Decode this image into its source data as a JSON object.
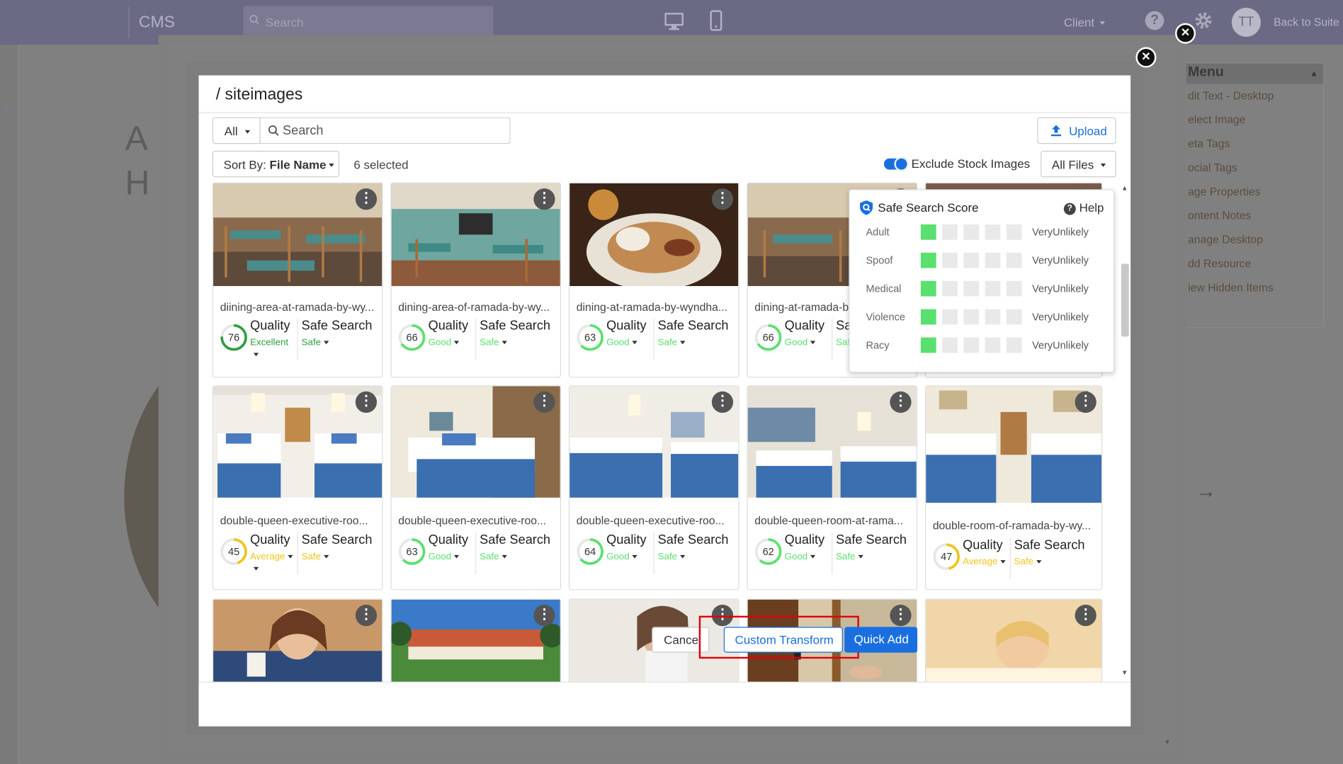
{
  "app": {
    "name": "CMS",
    "search_placeholder": "Search",
    "client_label": "Client",
    "avatar_initials": "TT",
    "back_to_suite": "Back to Suite"
  },
  "background": {
    "heading_line1": "A",
    "heading_line2": "H"
  },
  "right_menu": {
    "title": "Menu",
    "items": [
      "dit Text - Desktop",
      "elect Image",
      "eta Tags",
      "ocial Tags",
      "age Properties",
      "ontent Notes",
      "anage Desktop",
      "dd Resource",
      "iew Hidden Items"
    ]
  },
  "picker": {
    "title": "/ siteimages",
    "filter_all": "All",
    "search_placeholder": "Search",
    "upload_label": "Upload",
    "sort_by_label": "Sort By:",
    "sort_by_value": "File Name",
    "selected_count": "6 selected",
    "exclude_stock_label": "Exclude Stock Images",
    "exclude_stock_on": true,
    "all_files_label": "All Files"
  },
  "labels": {
    "quality": "Quality",
    "safe_search": "Safe Search"
  },
  "colors": {
    "excellent": "#2e9e3e",
    "good": "#5ae06e",
    "average": "#f0c419",
    "accent": "#1a6fe0",
    "highlight": "#e0000b"
  },
  "images": [
    {
      "name": "diining-area-at-ramada-by-wy...",
      "score": 76,
      "quality": "Excellent",
      "safe": "Safe",
      "theme": "dining1"
    },
    {
      "name": "dining-area-of-ramada-by-wy...",
      "score": 66,
      "quality": "Good",
      "safe": "Safe",
      "theme": "dining2"
    },
    {
      "name": "dining-at-ramada-by-wyndha...",
      "score": 63,
      "quality": "Good",
      "safe": "Safe",
      "theme": "food"
    },
    {
      "name": "dining-at-ramada-b",
      "score": 66,
      "quality": "Good",
      "safe": "Safe",
      "theme": "dining3"
    },
    {
      "name": "",
      "score": null,
      "quality": "",
      "safe": "",
      "theme": "partial"
    },
    {
      "name": "double-queen-executive-roo...",
      "score": 45,
      "quality": "Average",
      "safe": "Safe",
      "theme": "bed1"
    },
    {
      "name": "double-queen-executive-roo...",
      "score": 63,
      "quality": "Good",
      "safe": "Safe",
      "theme": "bed2"
    },
    {
      "name": "double-queen-executive-roo...",
      "score": 64,
      "quality": "Good",
      "safe": "Safe",
      "theme": "bed3"
    },
    {
      "name": "double-queen-room-at-rama...",
      "score": 62,
      "quality": "Good",
      "safe": "Safe",
      "theme": "bed4"
    },
    {
      "name": "double-room-of-ramada-by-wy...",
      "score": 47,
      "quality": "Average",
      "safe": "Safe",
      "theme": "bed5"
    },
    {
      "name": "",
      "score": null,
      "quality": "",
      "safe": "",
      "theme": "woman"
    },
    {
      "name": "",
      "score": null,
      "quality": "",
      "safe": "",
      "theme": "building"
    },
    {
      "name": "",
      "score": null,
      "quality": "",
      "safe": "",
      "theme": "phone"
    },
    {
      "name": "",
      "score": null,
      "quality": "",
      "safe": "",
      "theme": "door"
    },
    {
      "name": "",
      "score": null,
      "quality": "",
      "safe": "",
      "theme": "spa"
    }
  ],
  "safe_search_popover": {
    "title": "Safe Search Score",
    "help": "Help",
    "rows": [
      {
        "category": "Adult",
        "level": 1,
        "likelihood": "VeryUnlikely"
      },
      {
        "category": "Spoof",
        "level": 1,
        "likelihood": "VeryUnlikely"
      },
      {
        "category": "Medical",
        "level": 1,
        "likelihood": "VeryUnlikely"
      },
      {
        "category": "Violence",
        "level": 1,
        "likelihood": "VeryUnlikely"
      },
      {
        "category": "Racy",
        "level": 1,
        "likelihood": "VeryUnlikely"
      }
    ]
  },
  "footer": {
    "cancel": "Cancel",
    "custom_transform": "Custom Transform",
    "quick_add": "Quick Add"
  }
}
